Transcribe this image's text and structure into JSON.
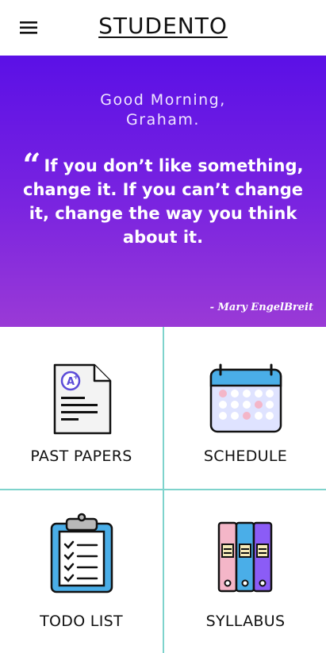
{
  "header": {
    "app_title": "STUDENTO",
    "menu_icon": "hamburger-menu-icon"
  },
  "hero": {
    "greeting": "Good Morning,\nGraham.",
    "quote_mark": "“",
    "quote": "If you don’t like something, change it. If you can’t change it, change the way you think about it.",
    "author": "- Mary EngelBreit",
    "colors": {
      "gradient_top": "#5b10e6",
      "gradient_bottom": "#9a3ad6"
    }
  },
  "tiles": [
    {
      "label": "PAST PAPERS",
      "icon": "exam-paper-icon"
    },
    {
      "label": "SCHEDULE",
      "icon": "calendar-icon"
    },
    {
      "label": "TODO LIST",
      "icon": "clipboard-checklist-icon"
    },
    {
      "label": "SYLLABUS",
      "icon": "binders-icon"
    }
  ],
  "colors": {
    "divider": "#7ed3cc",
    "accent_blue": "#4aaee8",
    "text": "#111111"
  }
}
